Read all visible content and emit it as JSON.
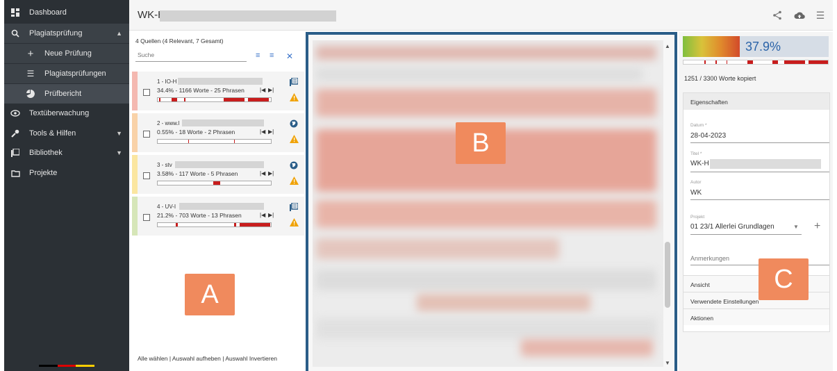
{
  "sidebar": {
    "items": [
      {
        "label": "Dashboard",
        "icon": "dashboard-icon"
      },
      {
        "label": "Plagiatsprüfung",
        "icon": "search-icon"
      },
      {
        "label": "Neue Prüfung",
        "icon": "plus-icon"
      },
      {
        "label": "Plagiatsprüfungen",
        "icon": "list-icon"
      },
      {
        "label": "Prüfbericht",
        "icon": "pie-chart-icon"
      },
      {
        "label": "Textüberwachung",
        "icon": "eye-icon"
      },
      {
        "label": "Tools & Hilfen",
        "icon": "wrench-icon"
      },
      {
        "label": "Bibliothek",
        "icon": "library-icon"
      },
      {
        "label": "Projekte",
        "icon": "folder-icon"
      }
    ],
    "flag_colors": [
      "#000000",
      "#dd0000",
      "#ffce00"
    ]
  },
  "header": {
    "title": "WK-H",
    "icons": [
      "share-icon",
      "cloud-upload-icon",
      "menu-icon"
    ]
  },
  "sources": {
    "summary": "4 Quellen (4 Relevant, 7 Gesamt)",
    "search_placeholder": "Suche",
    "items": [
      {
        "name": "1 - IO-H",
        "meta": "34.4% - 1166 Worte - 25 Phrasen",
        "stripe": "#f4b8b0",
        "type_icon": "library-icon"
      },
      {
        "name": "2 - www.l",
        "meta": "0.55% - 18 Worte - 2 Phrasen",
        "stripe": "#f9d2a8",
        "type_icon": "globe-icon"
      },
      {
        "name": "3 - stv",
        "meta": "3.58% - 117 Worte - 5 Phrasen",
        "stripe": "#fbe6a0",
        "type_icon": "globe-icon"
      },
      {
        "name": "4 - UV-I",
        "meta": "21.2% - 703 Worte - 13 Phrasen",
        "stripe": "#d6e6b8",
        "type_icon": "library-icon"
      }
    ],
    "footer": "Alle wählen | Auswahl aufheben | Auswahl Invertieren"
  },
  "labels": {
    "a": "A",
    "b": "B",
    "c": "C"
  },
  "report": {
    "percent": "37.9%",
    "copied": "1251 / 3300 Worte kopiert",
    "properties_header": "Eigenschaften",
    "fields": {
      "date_label": "Datum *",
      "date_value": "28-04-2023",
      "title_label": "Titel *",
      "title_value": "WK-H",
      "author_label": "Autor",
      "author_value": "WK",
      "project_label": "Projekt",
      "project_value": "01 23/1 Allerlei Grundlagen",
      "notes_label": "Anmerkungen"
    },
    "sections": [
      "Ansicht",
      "Verwendete Einstellungen",
      "Aktionen"
    ]
  },
  "colors": {
    "sidebar_bg": "#2b3035",
    "accent_blue": "#3a73c9",
    "match_red": "#c81d1d",
    "warning": "#f0a30a",
    "label_orange": "#f08a5d",
    "frame_blue": "#2a5d88"
  }
}
